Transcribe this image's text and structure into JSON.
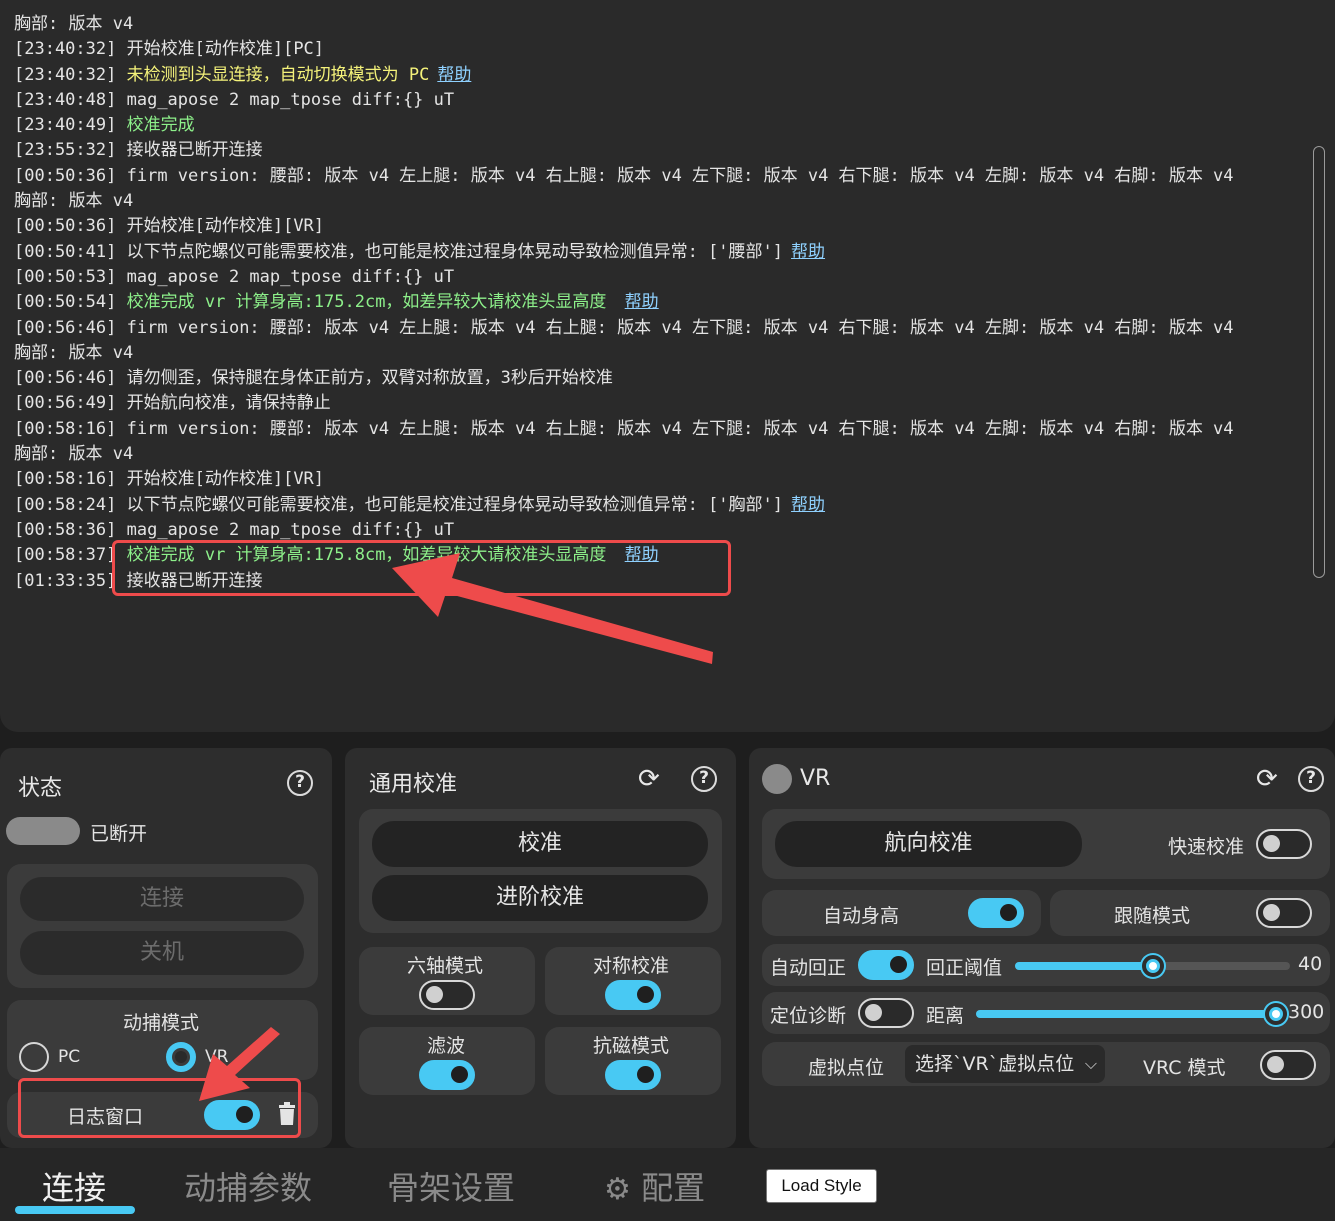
{
  "log": {
    "lines": [
      {
        "ts": "",
        "text": "胸部: 版本 v4",
        "color": "default",
        "help": ""
      },
      {
        "ts": "[23:40:32]",
        "text": "开始校准[动作校准][PC]",
        "color": "default",
        "help": ""
      },
      {
        "ts": "[23:40:32]",
        "text": "未检测到头显连接，自动切换模式为 PC",
        "color": "yellow",
        "help": "帮助"
      },
      {
        "ts": "[23:40:48]",
        "text": "mag_apose 2 map_tpose diff:{} uT",
        "color": "default",
        "help": ""
      },
      {
        "ts": "[23:40:49]",
        "text": "校准完成",
        "color": "green",
        "help": ""
      },
      {
        "ts": "[23:55:32]",
        "text": "接收器已断开连接",
        "color": "default",
        "help": ""
      },
      {
        "ts": "[00:50:36]",
        "text": "firm version: 腰部: 版本 v4 左上腿: 版本 v4 右上腿: 版本 v4 左下腿: 版本 v4 右下腿: 版本 v4 左脚: 版本 v4 右脚: 版本 v4",
        "color": "default",
        "help": ""
      },
      {
        "ts": "",
        "text": "胸部: 版本 v4",
        "color": "default",
        "help": ""
      },
      {
        "ts": "[00:50:36]",
        "text": "开始校准[动作校准][VR]",
        "color": "default",
        "help": ""
      },
      {
        "ts": "[00:50:41]",
        "text": "以下节点陀螺仪可能需要校准，也可能是校准过程身体晃动导致检测值异常: ['腰部']",
        "color": "default",
        "help": "帮助"
      },
      {
        "ts": "[00:50:53]",
        "text": "mag_apose 2 map_tpose diff:{} uT",
        "color": "default",
        "help": ""
      },
      {
        "ts": "[00:50:54]",
        "text": "校准完成 vr 计算身高:175.2cm，如差异较大请校准头显高度 ",
        "color": "green",
        "help": "帮助"
      },
      {
        "ts": "[00:56:46]",
        "text": "firm version: 腰部: 版本 v4 左上腿: 版本 v4 右上腿: 版本 v4 左下腿: 版本 v4 右下腿: 版本 v4 左脚: 版本 v4 右脚: 版本 v4",
        "color": "default",
        "help": ""
      },
      {
        "ts": "",
        "text": "胸部: 版本 v4",
        "color": "default",
        "help": ""
      },
      {
        "ts": "[00:56:46]",
        "text": "请勿侧歪，保持腿在身体正前方，双臂对称放置，3秒后开始校准",
        "color": "default",
        "help": ""
      },
      {
        "ts": "[00:56:49]",
        "text": "开始航向校准，请保持静止",
        "color": "default",
        "help": ""
      },
      {
        "ts": "[00:58:16]",
        "text": "firm version: 腰部: 版本 v4 左上腿: 版本 v4 右上腿: 版本 v4 左下腿: 版本 v4 右下腿: 版本 v4 左脚: 版本 v4 右脚: 版本 v4",
        "color": "default",
        "help": ""
      },
      {
        "ts": "",
        "text": "胸部: 版本 v4",
        "color": "default",
        "help": ""
      },
      {
        "ts": "[00:58:16]",
        "text": "开始校准[动作校准][VR]",
        "color": "default",
        "help": ""
      },
      {
        "ts": "[00:58:24]",
        "text": "以下节点陀螺仪可能需要校准，也可能是校准过程身体晃动导致检测值异常: ['胸部']",
        "color": "default",
        "help": "帮助"
      },
      {
        "ts": "[00:58:36]",
        "text": "mag_apose 2 map_tpose diff:{} uT",
        "color": "default",
        "help": ""
      },
      {
        "ts": "[00:58:37]",
        "text": "校准完成 vr 计算身高:175.8cm，如差异较大请校准头显高度 ",
        "color": "green",
        "help": "帮助"
      },
      {
        "ts": "[01:33:35]",
        "text": "接收器已断开连接",
        "color": "default",
        "help": ""
      }
    ]
  },
  "status": {
    "title": "状态",
    "state_label": "已断开",
    "connect_label": "连接",
    "shutdown_label": "关机",
    "mocap_mode_title": "动捕模式",
    "mode_pc": "PC",
    "mode_vr": "VR",
    "mode_selected": "VR",
    "log_window_label": "日志窗口",
    "log_window_on": true
  },
  "general_calib": {
    "title": "通用校准",
    "calibrate_label": "校准",
    "advanced_label": "进阶校准",
    "six_axis_label": "六轴模式",
    "six_axis_on": false,
    "symmetric_label": "对称校准",
    "symmetric_on": true,
    "filter_label": "滤波",
    "filter_on": true,
    "anti_mag_label": "抗磁模式",
    "anti_mag_on": true
  },
  "vr": {
    "title": "VR",
    "heading_calib_label": "航向校准",
    "quick_calib_label": "快速校准",
    "quick_calib_on": false,
    "auto_height_label": "自动身高",
    "auto_height_on": true,
    "follow_mode_label": "跟随模式",
    "follow_mode_on": false,
    "auto_recenter_label": "自动回正",
    "auto_recenter_on": true,
    "recenter_threshold_label": "回正阈值",
    "recenter_threshold_value": "40",
    "recenter_threshold_fraction": 0.5,
    "locate_diag_label": "定位诊断",
    "locate_diag_on": false,
    "distance_label": "距离",
    "distance_value": "300",
    "distance_fraction": 1.0,
    "virtual_point_label": "虚拟点位",
    "virtual_point_select": "选择`VR`虚拟点位",
    "vrc_mode_label": "VRC 模式",
    "vrc_mode_on": false
  },
  "tabs": [
    "连接",
    "动捕参数",
    "骨架设置",
    "配置"
  ],
  "active_tab": "连接",
  "load_style_label": "Load Style",
  "colors": {
    "accent": "#48c9f3",
    "highlight": "#ee4b4b",
    "log_yellow": "#f4f27a",
    "log_green": "#8df08a",
    "link": "#8fd1ff"
  }
}
